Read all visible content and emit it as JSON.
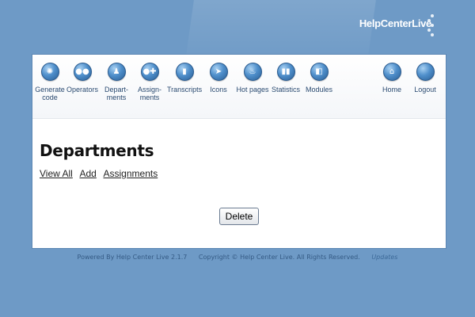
{
  "brand": {
    "name": "HelpCenterLive"
  },
  "nav": [
    {
      "label": "Generate\ncode",
      "icon": "gear-icon",
      "glyph": "✺"
    },
    {
      "label": "Operators",
      "icon": "operators-icon",
      "glyph": "●●"
    },
    {
      "label": "Depart-\nments",
      "icon": "departments-icon",
      "glyph": "♟"
    },
    {
      "label": "Assign-\nments",
      "icon": "assignments-icon",
      "glyph": "●✚"
    },
    {
      "label": "Transcripts",
      "icon": "document-icon",
      "glyph": "▮"
    },
    {
      "label": "Icons",
      "icon": "cursor-icon",
      "glyph": "➤"
    },
    {
      "label": "Hot pages",
      "icon": "flame-icon",
      "glyph": "♨"
    },
    {
      "label": "Statistics",
      "icon": "statistics-icon",
      "glyph": "▮▮"
    },
    {
      "label": "Modules",
      "icon": "modules-icon",
      "glyph": "◧"
    },
    {
      "label": "Home",
      "icon": "home-icon",
      "glyph": "⌂"
    },
    {
      "label": "Logout",
      "icon": "logout-icon",
      "glyph": ""
    }
  ],
  "page": {
    "title": "Departments",
    "tabs": [
      "View All",
      "Add",
      "Assignments"
    ],
    "delete_label": "Delete"
  },
  "footer": {
    "powered": "Powered By Help Center Live 2.1.7",
    "copyright": "Copyright © Help Center Live. All Rights Reserved.",
    "updates": "Updates"
  },
  "colors": {
    "background": "#6e9ac6",
    "panel": "#ffffff",
    "icon_blue": "#4f8fcb"
  }
}
